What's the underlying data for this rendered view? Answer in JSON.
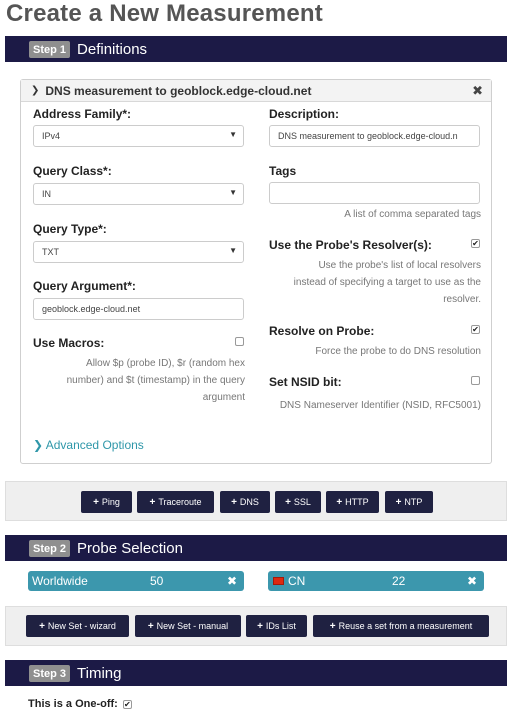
{
  "page_title": "Create a New Measurement",
  "steps": [
    {
      "badge": "Step 1",
      "title": "Definitions"
    },
    {
      "badge": "Step 2",
      "title": "Probe Selection"
    },
    {
      "badge": "Step 3",
      "title": "Timing"
    }
  ],
  "measurement": {
    "header": "DNS measurement to geoblock.edge-cloud.net",
    "close_icon": "✖",
    "address_family": {
      "label": "Address Family*:",
      "value": "IPv4"
    },
    "query_class": {
      "label": "Query Class*:",
      "value": "IN"
    },
    "query_type": {
      "label": "Query Type*:",
      "value": "TXT"
    },
    "query_argument": {
      "label": "Query Argument*:",
      "value": "geoblock.edge-cloud.net"
    },
    "use_macros": {
      "label": "Use Macros:",
      "checked": false,
      "help": [
        "Allow $p (probe ID), $r (random hex",
        "number) and $t (timestamp) in the query",
        "argument"
      ]
    },
    "description": {
      "label": "Description:",
      "value": "DNS measurement to geoblock.edge-cloud.n"
    },
    "tags": {
      "label": "Tags",
      "value": "",
      "help": "A list of comma separated tags"
    },
    "use_resolver": {
      "label": "Use the Probe's Resolver(s):",
      "checked": true,
      "help": [
        "Use the probe's list of local resolvers",
        "instead of specifying a target to use as the",
        "resolver."
      ]
    },
    "resolve_on_probe": {
      "label": "Resolve on Probe:",
      "checked": true,
      "help": "Force the probe to do DNS resolution"
    },
    "nsid": {
      "label": "Set NSID bit:",
      "checked": false,
      "help": "DNS Nameserver Identifier (NSID, RFC5001)"
    },
    "advanced": "Advanced Options"
  },
  "type_buttons": [
    "Ping",
    "Traceroute",
    "DNS",
    "SSL",
    "HTTP",
    "NTP"
  ],
  "probes": [
    {
      "name": "Worldwide",
      "count": "50"
    },
    {
      "name": "CN",
      "count": "22"
    }
  ],
  "set_buttons": [
    "New Set - wizard",
    "New Set - manual",
    "IDs List",
    "Reuse a set from a measurement"
  ],
  "timing": {
    "one_off_label": "This is a One-off:",
    "one_off_checked": true
  },
  "icons": {
    "chevron": "chevron-down-icon",
    "check": "✔",
    "plus": "+",
    "remove": "✖"
  },
  "colors": {
    "step_bar": "#1c1a46",
    "button": "#1f2141",
    "probe": "#3c97ad",
    "link": "#2f97a9"
  }
}
